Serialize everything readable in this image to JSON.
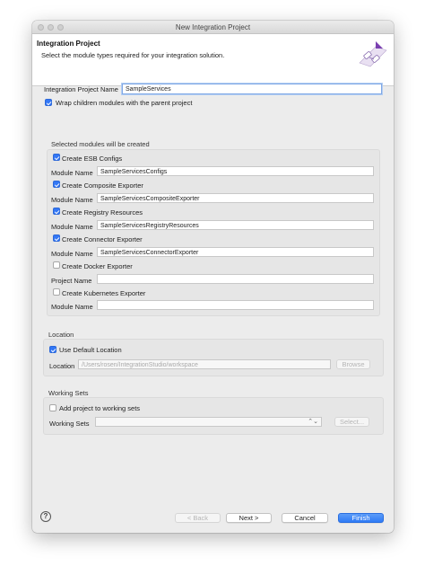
{
  "window": {
    "title": "New Integration Project"
  },
  "header": {
    "title": "Integration Project",
    "description": "Select the module types required for your integration solution."
  },
  "project": {
    "name_label": "Integration Project Name",
    "name_value": "SampleServices",
    "wrap_label": "Wrap children modules with the parent project",
    "wrap_checked": true
  },
  "modules": {
    "group_label": "Selected modules will be created",
    "items": [
      {
        "checkbox_label": "Create ESB Configs",
        "checked": true,
        "field_label": "Module Name",
        "field_value": "SampleServicesConfigs"
      },
      {
        "checkbox_label": "Create Composite Exporter",
        "checked": true,
        "field_label": "Module Name",
        "field_value": "SampleServicesCompositeExporter"
      },
      {
        "checkbox_label": "Create Registry Resources",
        "checked": true,
        "field_label": "Module Name",
        "field_value": "SampleServicesRegistryResources"
      },
      {
        "checkbox_label": "Create Connector Exporter",
        "checked": true,
        "field_label": "Module Name",
        "field_value": "SampleServicesConnectorExporter"
      },
      {
        "checkbox_label": "Create Docker Exporter",
        "checked": false,
        "field_label": "Project Name",
        "field_value": ""
      },
      {
        "checkbox_label": "Create Kubernetes Exporter",
        "checked": false,
        "field_label": "Module Name",
        "field_value": ""
      }
    ]
  },
  "location": {
    "group_label": "Location",
    "default_label": "Use Default Location",
    "default_checked": true,
    "field_label": "Location",
    "field_value": "/Users/rosen/IntegrationStudio/workspace",
    "browse_label": "Browse"
  },
  "working_sets": {
    "group_label": "Working Sets",
    "add_label": "Add project to working sets",
    "add_checked": false,
    "field_label": "Working Sets",
    "field_value": "",
    "select_label": "Select..."
  },
  "footer": {
    "back_label": "< Back",
    "next_label": "Next >",
    "cancel_label": "Cancel",
    "finish_label": "Finish",
    "help_glyph": "?"
  },
  "colors": {
    "accent": "#3478f6",
    "window_bg": "#ececec",
    "header_bg": "#ffffff"
  }
}
